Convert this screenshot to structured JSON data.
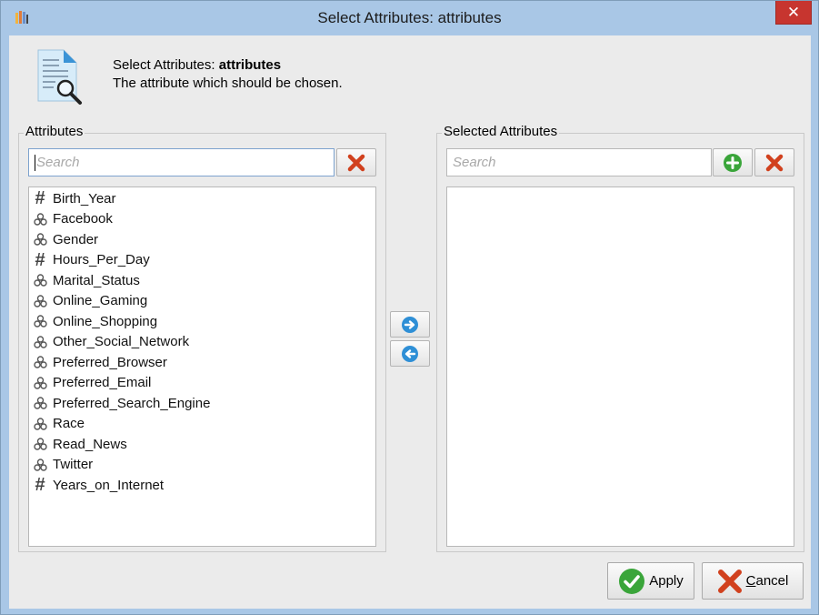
{
  "window": {
    "title": "Select Attributes: attributes",
    "close_symbol": "✕"
  },
  "header": {
    "title_prefix": "Select Attributes: ",
    "title_bold": "attributes",
    "description": "The attribute which should be chosen.",
    "icon": "document-search-icon"
  },
  "left_panel": {
    "label": "Attributes",
    "search": {
      "placeholder": "Search",
      "value": ""
    },
    "items": [
      {
        "label": "Birth_Year",
        "type": "numeric"
      },
      {
        "label": "Facebook",
        "type": "nominal"
      },
      {
        "label": "Gender",
        "type": "nominal"
      },
      {
        "label": "Hours_Per_Day",
        "type": "numeric"
      },
      {
        "label": "Marital_Status",
        "type": "nominal"
      },
      {
        "label": "Online_Gaming",
        "type": "nominal"
      },
      {
        "label": "Online_Shopping",
        "type": "nominal"
      },
      {
        "label": "Other_Social_Network",
        "type": "nominal"
      },
      {
        "label": "Preferred_Browser",
        "type": "nominal"
      },
      {
        "label": "Preferred_Email",
        "type": "nominal"
      },
      {
        "label": "Preferred_Search_Engine",
        "type": "nominal"
      },
      {
        "label": "Race",
        "type": "nominal"
      },
      {
        "label": "Read_News",
        "type": "nominal"
      },
      {
        "label": "Twitter",
        "type": "nominal"
      },
      {
        "label": "Years_on_Internet",
        "type": "numeric"
      }
    ]
  },
  "right_panel": {
    "label": "Selected Attributes",
    "search": {
      "placeholder": "Search",
      "value": ""
    },
    "items": []
  },
  "footer": {
    "apply_label": "Apply",
    "cancel_mnemonic": "C",
    "cancel_rest": "ancel"
  },
  "colors": {
    "titlebar": "#a9c7e6",
    "close": "#c7352f",
    "dialog_bg": "#ebebeb",
    "arrow_blue": "#2e8fd6",
    "add_green": "#3aa53a",
    "remove_red": "#d1411e"
  }
}
